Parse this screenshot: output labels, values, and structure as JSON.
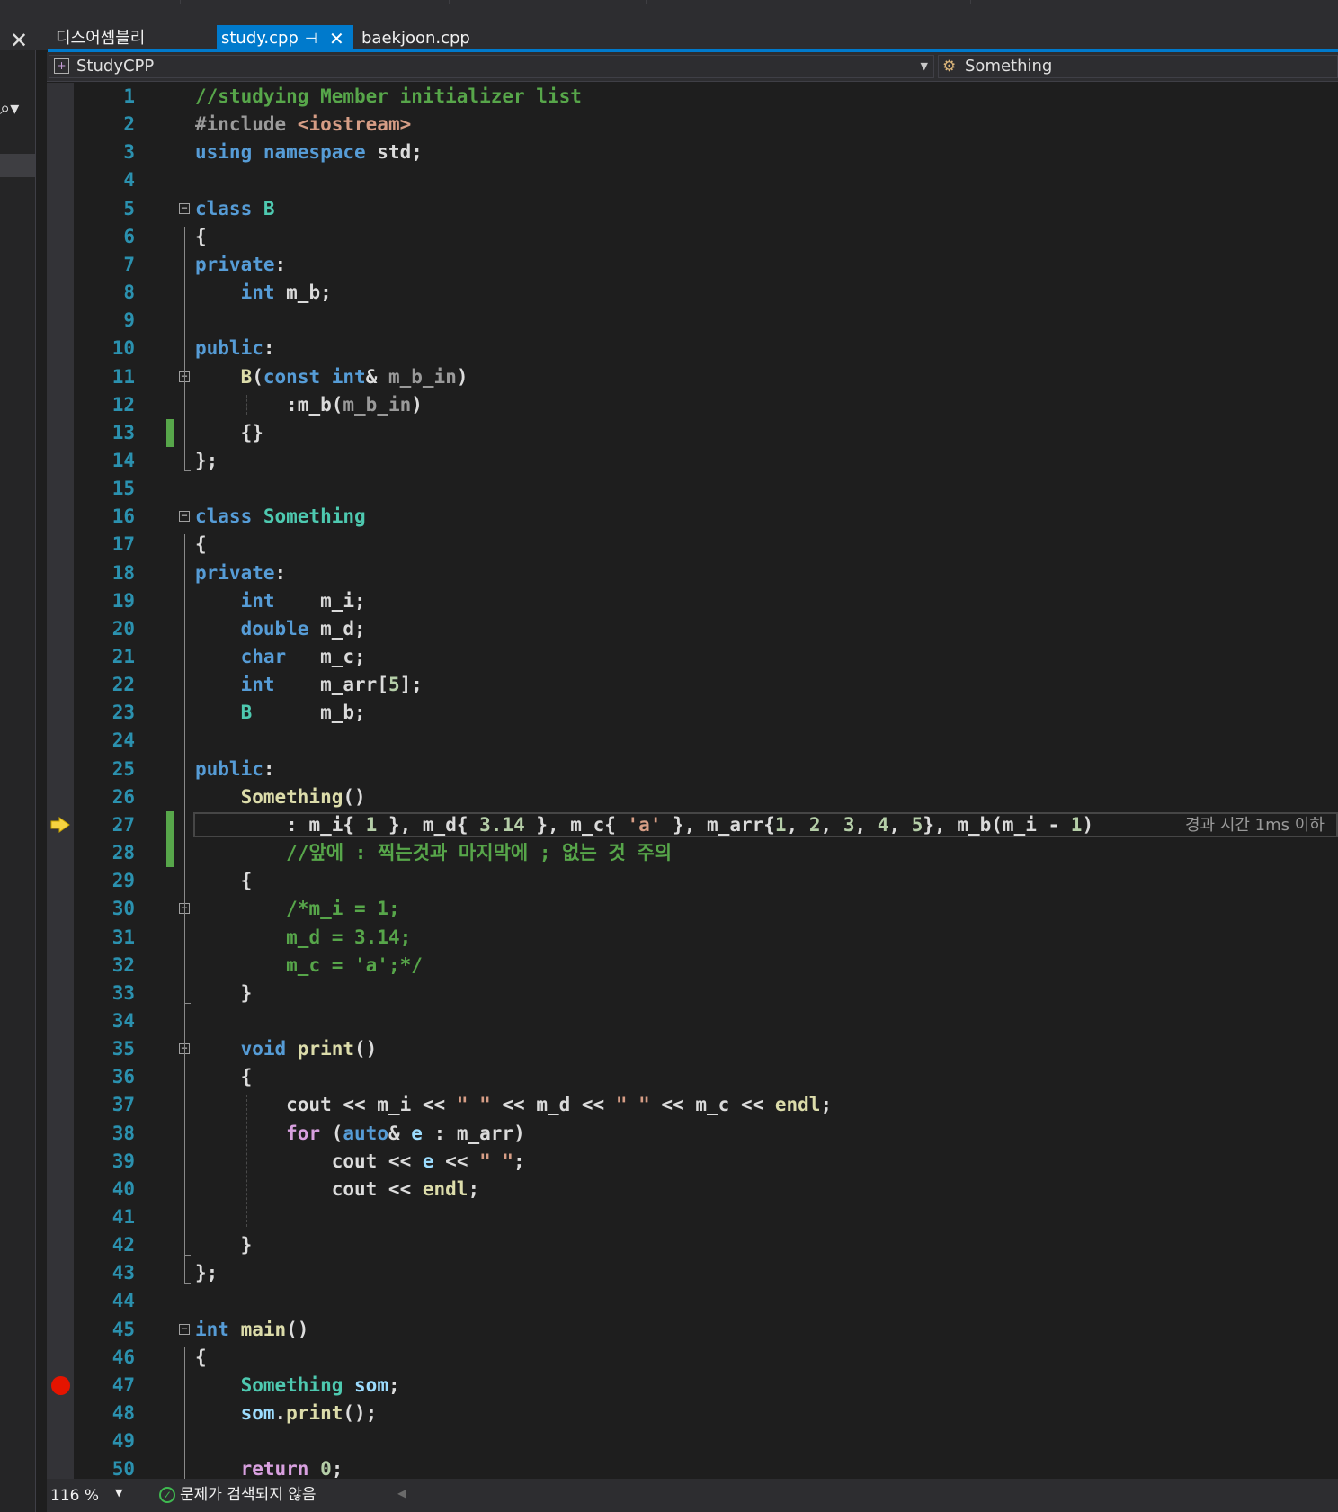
{
  "tabs": {
    "close_glyph": "✕",
    "disassembly": "디스어셈블리",
    "active": "study.cpp",
    "active_pin": "⊣",
    "active_close": "✕",
    "other": "baekjoon.cpp"
  },
  "navbar": {
    "project": "StudyCPP",
    "scope": "Something"
  },
  "editor": {
    "lines": [
      {
        "n": "1",
        "t": [
          {
            "c": "cm",
            "t": "//studying Member initializer list"
          }
        ]
      },
      {
        "n": "2",
        "t": [
          {
            "c": "pp",
            "t": "#include "
          },
          {
            "c": "st",
            "t": "<iostream>"
          }
        ]
      },
      {
        "n": "3",
        "t": [
          {
            "c": "kw",
            "t": "using namespace "
          },
          {
            "t": "std;"
          }
        ]
      },
      {
        "n": "4",
        "t": []
      },
      {
        "n": "5",
        "t": [
          {
            "c": "kw",
            "t": "class "
          },
          {
            "c": "ty",
            "t": "B"
          }
        ]
      },
      {
        "n": "6",
        "t": [
          {
            "t": "{"
          }
        ]
      },
      {
        "n": "7",
        "t": [
          {
            "c": "kw",
            "t": "private"
          },
          {
            "t": ":"
          }
        ]
      },
      {
        "n": "8",
        "t": [
          {
            "t": "    "
          },
          {
            "c": "kw",
            "t": "int "
          },
          {
            "c": "mv",
            "t": "m_b"
          },
          {
            "t": ";"
          }
        ]
      },
      {
        "n": "9",
        "t": []
      },
      {
        "n": "10",
        "t": [
          {
            "c": "kw",
            "t": "public"
          },
          {
            "t": ":"
          }
        ]
      },
      {
        "n": "11",
        "t": [
          {
            "t": "    "
          },
          {
            "c": "fn",
            "t": "B"
          },
          {
            "t": "("
          },
          {
            "c": "kw",
            "t": "const int"
          },
          {
            "t": "& "
          },
          {
            "c": "pa",
            "t": "m_b_in"
          },
          {
            "t": ")"
          }
        ]
      },
      {
        "n": "12",
        "t": [
          {
            "t": "        :"
          },
          {
            "c": "mv",
            "t": "m_b"
          },
          {
            "t": "("
          },
          {
            "c": "pa",
            "t": "m_b_in"
          },
          {
            "t": ")"
          }
        ]
      },
      {
        "n": "13",
        "t": [
          {
            "t": "    {}"
          }
        ]
      },
      {
        "n": "14",
        "t": [
          {
            "t": "};"
          }
        ]
      },
      {
        "n": "15",
        "t": []
      },
      {
        "n": "16",
        "t": [
          {
            "c": "kw",
            "t": "class "
          },
          {
            "c": "ty",
            "t": "Something"
          }
        ]
      },
      {
        "n": "17",
        "t": [
          {
            "t": "{"
          }
        ]
      },
      {
        "n": "18",
        "t": [
          {
            "c": "kw",
            "t": "private"
          },
          {
            "t": ":"
          }
        ]
      },
      {
        "n": "19",
        "t": [
          {
            "t": "    "
          },
          {
            "c": "kw",
            "t": "int    "
          },
          {
            "c": "mv",
            "t": "m_i"
          },
          {
            "t": ";"
          }
        ]
      },
      {
        "n": "20",
        "t": [
          {
            "t": "    "
          },
          {
            "c": "kw",
            "t": "double "
          },
          {
            "c": "mv",
            "t": "m_d"
          },
          {
            "t": ";"
          }
        ]
      },
      {
        "n": "21",
        "t": [
          {
            "t": "    "
          },
          {
            "c": "kw",
            "t": "char   "
          },
          {
            "c": "mv",
            "t": "m_c"
          },
          {
            "t": ";"
          }
        ]
      },
      {
        "n": "22",
        "t": [
          {
            "t": "    "
          },
          {
            "c": "kw",
            "t": "int    "
          },
          {
            "c": "mv",
            "t": "m_arr"
          },
          {
            "t": "["
          },
          {
            "c": "nm",
            "t": "5"
          },
          {
            "t": "];"
          }
        ]
      },
      {
        "n": "23",
        "t": [
          {
            "t": "    "
          },
          {
            "c": "ty",
            "t": "B      "
          },
          {
            "c": "mv",
            "t": "m_b"
          },
          {
            "t": ";"
          }
        ]
      },
      {
        "n": "24",
        "t": []
      },
      {
        "n": "25",
        "t": [
          {
            "c": "kw",
            "t": "public"
          },
          {
            "t": ":"
          }
        ]
      },
      {
        "n": "26",
        "t": [
          {
            "t": "    "
          },
          {
            "c": "fn",
            "t": "Something"
          },
          {
            "t": "()"
          }
        ]
      },
      {
        "n": "27",
        "t": [
          {
            "t": "        : "
          },
          {
            "c": "mv",
            "t": "m_i"
          },
          {
            "t": "{ "
          },
          {
            "c": "nm",
            "t": "1"
          },
          {
            "t": " }, "
          },
          {
            "c": "mv",
            "t": "m_d"
          },
          {
            "t": "{ "
          },
          {
            "c": "nm",
            "t": "3.14"
          },
          {
            "t": " }, "
          },
          {
            "c": "mv",
            "t": "m_c"
          },
          {
            "t": "{ "
          },
          {
            "c": "st",
            "t": "'a'"
          },
          {
            "t": " }, "
          },
          {
            "c": "mv",
            "t": "m_arr"
          },
          {
            "t": "{"
          },
          {
            "c": "nm",
            "t": "1"
          },
          {
            "t": ", "
          },
          {
            "c": "nm",
            "t": "2"
          },
          {
            "t": ", "
          },
          {
            "c": "nm",
            "t": "3"
          },
          {
            "t": ", "
          },
          {
            "c": "nm",
            "t": "4"
          },
          {
            "t": ", "
          },
          {
            "c": "nm",
            "t": "5"
          },
          {
            "t": "}, "
          },
          {
            "c": "mv",
            "t": "m_b"
          },
          {
            "t": "("
          },
          {
            "c": "mv",
            "t": "m_i"
          },
          {
            "t": " - "
          },
          {
            "c": "nm",
            "t": "1"
          },
          {
            "t": ")"
          }
        ]
      },
      {
        "n": "28",
        "t": [
          {
            "t": "        "
          },
          {
            "c": "cm",
            "t": "//앞에 : 찍는것과 마지막에 ; 없는 것 주의"
          }
        ]
      },
      {
        "n": "29",
        "t": [
          {
            "t": "    {"
          }
        ]
      },
      {
        "n": "30",
        "t": [
          {
            "t": "        "
          },
          {
            "c": "cm",
            "t": "/*m_i = 1;"
          }
        ]
      },
      {
        "n": "31",
        "t": [
          {
            "t": "        "
          },
          {
            "c": "cm",
            "t": "m_d = 3.14;"
          }
        ]
      },
      {
        "n": "32",
        "t": [
          {
            "t": "        "
          },
          {
            "c": "cm",
            "t": "m_c = 'a';*/"
          }
        ]
      },
      {
        "n": "33",
        "t": [
          {
            "t": "    }"
          }
        ]
      },
      {
        "n": "34",
        "t": []
      },
      {
        "n": "35",
        "t": [
          {
            "t": "    "
          },
          {
            "c": "kw",
            "t": "void "
          },
          {
            "c": "fn",
            "t": "print"
          },
          {
            "t": "()"
          }
        ]
      },
      {
        "n": "36",
        "t": [
          {
            "t": "    {"
          }
        ]
      },
      {
        "n": "37",
        "t": [
          {
            "t": "        cout << "
          },
          {
            "c": "mv",
            "t": "m_i"
          },
          {
            "t": " << "
          },
          {
            "c": "st",
            "t": "\" \""
          },
          {
            "t": " << "
          },
          {
            "c": "mv",
            "t": "m_d"
          },
          {
            "t": " << "
          },
          {
            "c": "st",
            "t": "\" \""
          },
          {
            "t": " << "
          },
          {
            "c": "mv",
            "t": "m_c"
          },
          {
            "t": " << "
          },
          {
            "c": "fn",
            "t": "endl"
          },
          {
            "t": ";"
          }
        ]
      },
      {
        "n": "38",
        "t": [
          {
            "t": "        "
          },
          {
            "c": "ct",
            "t": "for"
          },
          {
            "t": " ("
          },
          {
            "c": "kw",
            "t": "auto"
          },
          {
            "t": "& "
          },
          {
            "c": "lv",
            "t": "e"
          },
          {
            "t": " : "
          },
          {
            "c": "mv",
            "t": "m_arr"
          },
          {
            "t": ")"
          }
        ]
      },
      {
        "n": "39",
        "t": [
          {
            "t": "            cout << "
          },
          {
            "c": "lv",
            "t": "e"
          },
          {
            "t": " << "
          },
          {
            "c": "st",
            "t": "\" \""
          },
          {
            "t": ";"
          }
        ]
      },
      {
        "n": "40",
        "t": [
          {
            "t": "            cout << "
          },
          {
            "c": "fn",
            "t": "endl"
          },
          {
            "t": ";"
          }
        ]
      },
      {
        "n": "41",
        "t": []
      },
      {
        "n": "42",
        "t": [
          {
            "t": "    }"
          }
        ]
      },
      {
        "n": "43",
        "t": [
          {
            "t": "};"
          }
        ]
      },
      {
        "n": "44",
        "t": []
      },
      {
        "n": "45",
        "t": [
          {
            "c": "kw",
            "t": "int "
          },
          {
            "c": "fn",
            "t": "main"
          },
          {
            "t": "()"
          }
        ]
      },
      {
        "n": "46",
        "t": [
          {
            "t": "{"
          }
        ]
      },
      {
        "n": "47",
        "t": [
          {
            "t": "    "
          },
          {
            "c": "ty",
            "t": "Something"
          },
          {
            "t": " "
          },
          {
            "c": "lv",
            "t": "som"
          },
          {
            "t": ";"
          }
        ]
      },
      {
        "n": "48",
        "t": [
          {
            "t": "    "
          },
          {
            "c": "lv",
            "t": "som"
          },
          {
            "t": "."
          },
          {
            "c": "fn",
            "t": "print"
          },
          {
            "t": "();"
          }
        ]
      },
      {
        "n": "49",
        "t": []
      },
      {
        "n": "50",
        "t": [
          {
            "t": "    "
          },
          {
            "c": "ct",
            "t": "return"
          },
          {
            "t": " "
          },
          {
            "c": "nm",
            "t": "0"
          },
          {
            "t": ";"
          }
        ]
      }
    ],
    "elapsed_hint": "경과 시간 1ms 이하",
    "current_line": "27",
    "breakpoint_line": "47",
    "changed_lines": [
      "13",
      "27",
      "28"
    ],
    "fold_lines": [
      "5",
      "11",
      "16",
      "30",
      "35",
      "45"
    ]
  },
  "statusbar": {
    "zoom": "116 %",
    "issues": "문제가 검색되지 않음"
  },
  "colors": {
    "accent": "#007acc",
    "breakpoint": "#e51400",
    "change_bar": "#57a64a"
  }
}
